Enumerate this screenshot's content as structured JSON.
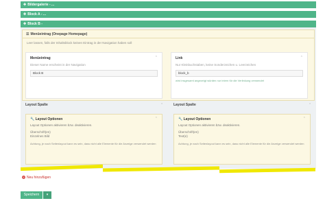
{
  "accordion": [
    {
      "label": "Bildergalerie - ..."
    },
    {
      "label": "Block A - ..."
    },
    {
      "label": "Block B -"
    }
  ],
  "menu_panel": {
    "title": "Menüeintrag (Onepage Homepage)",
    "description": "Leer lassen, falls der Inhaltsblock keinen Eintrag in der Navigation haben soll"
  },
  "fields": [
    {
      "title": "Menüeintrag",
      "hint": "Dieser Name erscheint in der Navigation",
      "value": "Block B",
      "note": ""
    },
    {
      "title": "Link",
      "hint": "Nur Kleinbuchstaben, keine Sonderzeichen u. Leerzeichen",
      "value": "block_b",
      "note": "wird insgesamt angezeigt würden nur intern für die Verlinkung verwendet"
    }
  ],
  "columns": [
    {
      "header": "Layout Spalte",
      "panel_title": "Layout Optionen",
      "desc": "Layout Optionen aktivieren bzw. deaktivieren.",
      "item1": "Überschrift(en)",
      "item2": "Einzelnes Bild",
      "warning": "Achtung, je nach Seitenlayout kann es sein, dass nicht alle Elemente für die Anzeige verwendet werden"
    },
    {
      "header": "Layout Spalte",
      "panel_title": "Layout Optionen",
      "desc": "Layout Optionen aktivieren bzw. deaktivieren.",
      "item1": "Überschrift(en)",
      "item2": "Text(e)",
      "warning": "Achtung, je nach Seitenlayout kann es sein, dass nicht alle Elemente für die Anzeige verwendet werden"
    }
  ],
  "actions": {
    "add_label": "Neu hinzufügen",
    "save_label": "Speichern",
    "dropdown_glyph": "▾"
  },
  "colors": {
    "accent": "#4fb589",
    "warning_bg": "#fcf8e3",
    "highlight": "#f0e800",
    "danger": "#d9534f"
  }
}
